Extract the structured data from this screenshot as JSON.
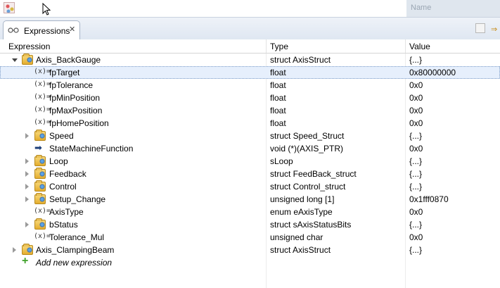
{
  "topbar": {
    "right_text": "Name"
  },
  "tab": {
    "label": "Expressions",
    "close": "✕"
  },
  "columns": {
    "expression": "Expression",
    "type": "Type",
    "value": "Value"
  },
  "rows": [
    {
      "name": "Axis_BackGauge",
      "type": "struct AxisStruct",
      "value": "{...}",
      "icon": "struct-folder-icon",
      "expander": "open"
    },
    {
      "name": "fpTarget",
      "type": "float",
      "value": "0x80000000",
      "icon": "variable-icon",
      "selected": true
    },
    {
      "name": "fpTolerance",
      "type": "float",
      "value": "0x0",
      "icon": "variable-icon"
    },
    {
      "name": "fpMinPosition",
      "type": "float",
      "value": "0x0",
      "icon": "variable-icon"
    },
    {
      "name": "fpMaxPosition",
      "type": "float",
      "value": "0x0",
      "icon": "variable-icon"
    },
    {
      "name": "fpHomePosition",
      "type": "float",
      "value": "0x0",
      "icon": "variable-icon"
    },
    {
      "name": "Speed",
      "type": "struct Speed_Struct",
      "value": "{...}",
      "icon": "struct-folder-icon",
      "expander": "closed"
    },
    {
      "name": "StateMachineFunction",
      "type": "void (*)(AXIS_PTR)",
      "value": "0x0",
      "icon": "pointer-arrow-icon"
    },
    {
      "name": "Loop",
      "type": "sLoop",
      "value": "{...}",
      "icon": "struct-folder-icon",
      "expander": "closed"
    },
    {
      "name": "Feedback",
      "type": "struct FeedBack_struct",
      "value": "{...}",
      "icon": "struct-folder-icon",
      "expander": "closed"
    },
    {
      "name": "Control",
      "type": "struct Control_struct",
      "value": "{...}",
      "icon": "struct-folder-icon",
      "expander": "closed"
    },
    {
      "name": "Setup_Change",
      "type": "unsigned long [1]",
      "value": "0x1fff0870",
      "icon": "struct-folder-icon",
      "expander": "closed"
    },
    {
      "name": "AxisType",
      "type": "enum eAxisType",
      "value": "0x0",
      "icon": "variable-icon"
    },
    {
      "name": "bStatus",
      "type": "struct sAxisStatusBits",
      "value": "{...}",
      "icon": "struct-folder-icon",
      "expander": "closed"
    },
    {
      "name": "Tolerance_Mul",
      "type": "unsigned char",
      "value": "0x0",
      "icon": "variable-icon"
    },
    {
      "name": "Axis_ClampingBeam",
      "type": "struct AxisStruct",
      "value": "{...}",
      "icon": "struct-folder-icon",
      "expander": "closed"
    }
  ],
  "variable_glyph": "(x)=",
  "add_expression": "Add new expression"
}
